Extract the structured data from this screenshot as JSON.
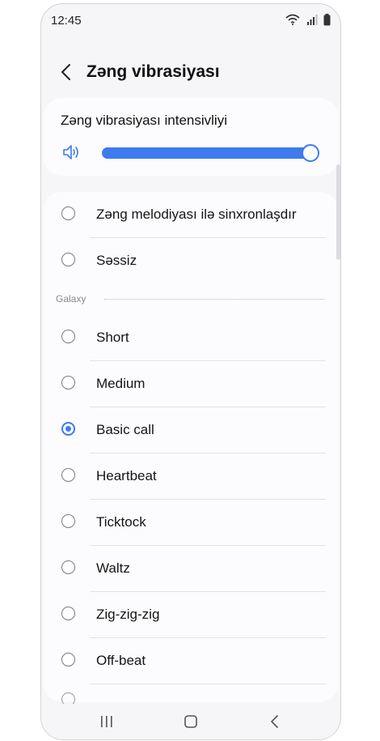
{
  "status_bar": {
    "time": "12:45",
    "icons": [
      "wifi-icon",
      "signal-icon",
      "battery-icon"
    ]
  },
  "header": {
    "back_icon": "chevron-left-icon",
    "title": "Zəng vibrasiyası"
  },
  "intensity": {
    "label": "Zəng vibrasiyası intensivliyi",
    "icon": "volume-icon",
    "level": 1.0
  },
  "options_top": [
    {
      "label": "Zəng melodiyası ilə sinxronlaşdır",
      "checked": false
    },
    {
      "label": "Səssiz",
      "checked": false
    }
  ],
  "section": {
    "label": "Galaxy"
  },
  "options_galaxy": [
    {
      "label": "Short",
      "checked": false
    },
    {
      "label": "Medium",
      "checked": false
    },
    {
      "label": "Basic call",
      "checked": true
    },
    {
      "label": "Heartbeat",
      "checked": false
    },
    {
      "label": "Ticktock",
      "checked": false
    },
    {
      "label": "Waltz",
      "checked": false
    },
    {
      "label": "Zig-zig-zig",
      "checked": false
    },
    {
      "label": "Off-beat",
      "checked": false
    }
  ],
  "nav_bar": {
    "icons": [
      "recent-apps-icon",
      "home-icon",
      "back-icon"
    ]
  },
  "colors": {
    "accent": "#3d7bef",
    "background": "#f6f6f9",
    "card": "#fcfcfe"
  }
}
